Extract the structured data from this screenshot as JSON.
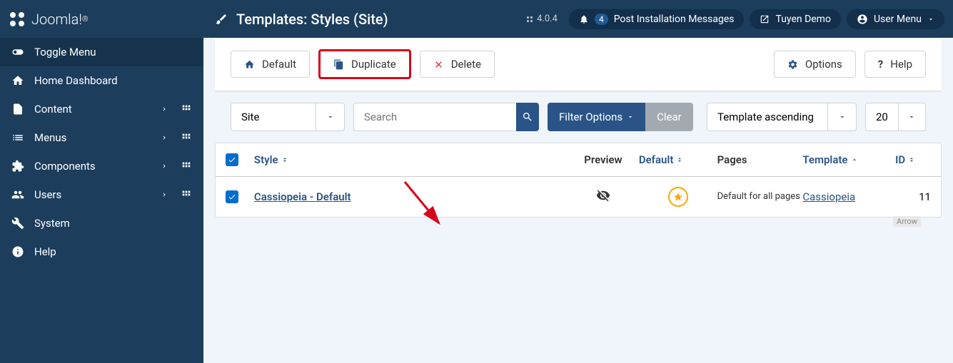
{
  "brand": "Joomla!",
  "page_title": "Templates: Styles (Site)",
  "version": "4.0.4",
  "header": {
    "messages_count": "4",
    "messages_label": "Post Installation Messages",
    "site_link": "Tuyen Demo",
    "user_menu": "User Menu"
  },
  "sidebar": {
    "toggle": "Toggle Menu",
    "items": [
      {
        "label": "Home Dashboard"
      },
      {
        "label": "Content"
      },
      {
        "label": "Menus"
      },
      {
        "label": "Components"
      },
      {
        "label": "Users"
      },
      {
        "label": "System"
      },
      {
        "label": "Help"
      }
    ]
  },
  "toolbar": {
    "default": "Default",
    "duplicate": "Duplicate",
    "delete": "Delete",
    "options": "Options",
    "help": "Help"
  },
  "filters": {
    "client": "Site",
    "search_placeholder": "Search",
    "filter_options": "Filter Options",
    "clear": "Clear",
    "sort": "Template ascending",
    "limit": "20"
  },
  "table": {
    "headers": {
      "style": "Style",
      "preview": "Preview",
      "default": "Default",
      "pages": "Pages",
      "template": "Template",
      "id": "ID"
    },
    "rows": [
      {
        "style": "Cassiopeia - Default",
        "pages": "Default for all pages",
        "template": "Cassiopeia",
        "id": "11"
      }
    ]
  },
  "annotation": {
    "arrow_label": "Arrow"
  }
}
